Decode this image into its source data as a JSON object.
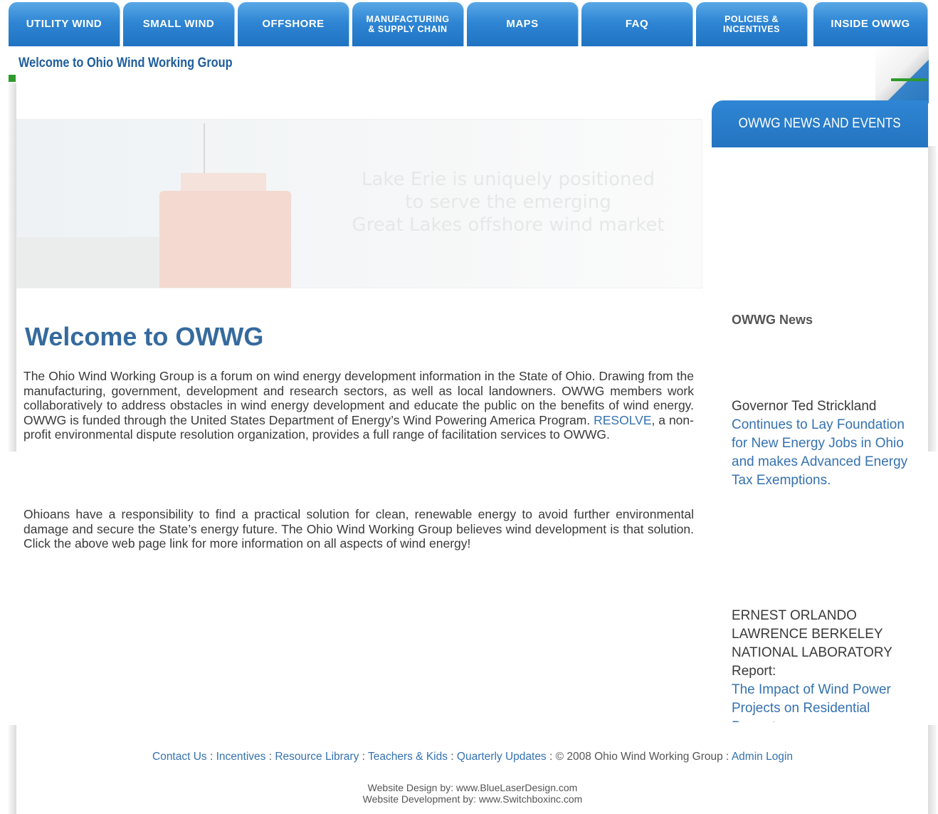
{
  "nav": {
    "tabs": [
      {
        "label": "UTILITY WIND"
      },
      {
        "label": "SMALL WIND"
      },
      {
        "label": "OFFSHORE"
      },
      {
        "label": "MANUFACTURING\n& SUPPLY CHAIN"
      },
      {
        "label": "MAPS"
      },
      {
        "label": "FAQ"
      },
      {
        "label": "POLICIES &\nINCENTIVES"
      },
      {
        "label": "INSIDE OWWG"
      }
    ]
  },
  "header": {
    "welcome": "Welcome to Ohio Wind Working Group"
  },
  "banner": {
    "caption": "Lake Erie is uniquely positioned\nto serve the emerging\nGreat Lakes offshore wind market"
  },
  "news_panel": {
    "title": "OWWG NEWS AND EVENTS"
  },
  "main": {
    "title": "Welcome to OWWG",
    "para1_a": "The Ohio Wind Working Group is a forum on wind energy development information in the State of Ohio. Drawing from the manufacturing, government, development and research sectors, as well as local landowners. OWWG members work collaboratively to address obstacles in wind energy development and educate the public on the benefits of wind energy. OWWG is funded through the United States Department of Energy’s Wind Powering America Program. ",
    "para1_link": "RESOLVE",
    "para1_b": ", a non-profit environmental dispute resolution organization, provides a full range of facilitation services to OWWG.",
    "para2": "Ohioans have a responsibility to find a practical solution for clean, renewable energy to avoid further environmental damage and secure the State’s energy future. The Ohio Wind Working Group believes wind development is that solution. Click the above web page link for more information on all aspects of wind energy!"
  },
  "sidebar": {
    "label": "OWWG News",
    "item1_text": "Governor Ted Strickland",
    "item1_link": "Continues to Lay Foundation for New Energy Jobs in Ohio and makes Advanced Energy Tax Exemptions.",
    "item2_text": "ERNEST ORLANDO LAWRENCE BERKELEY NATIONAL LABORATORY Report:",
    "item2_link": "The Impact of Wind Power Projects on Residential Property"
  },
  "footer": {
    "links": [
      "Contact Us",
      "Incentives",
      "Resource Library",
      "Teachers & Kids",
      "Quarterly Updates"
    ],
    "copyright": "© 2008 Ohio Wind Working Group",
    "admin": "Admin Login",
    "separator": " : ",
    "credit_design": "Website Design by:  www.BlueLaserDesign.com",
    "credit_dev": "Website Development by:  www.Switchboxinc.com"
  }
}
